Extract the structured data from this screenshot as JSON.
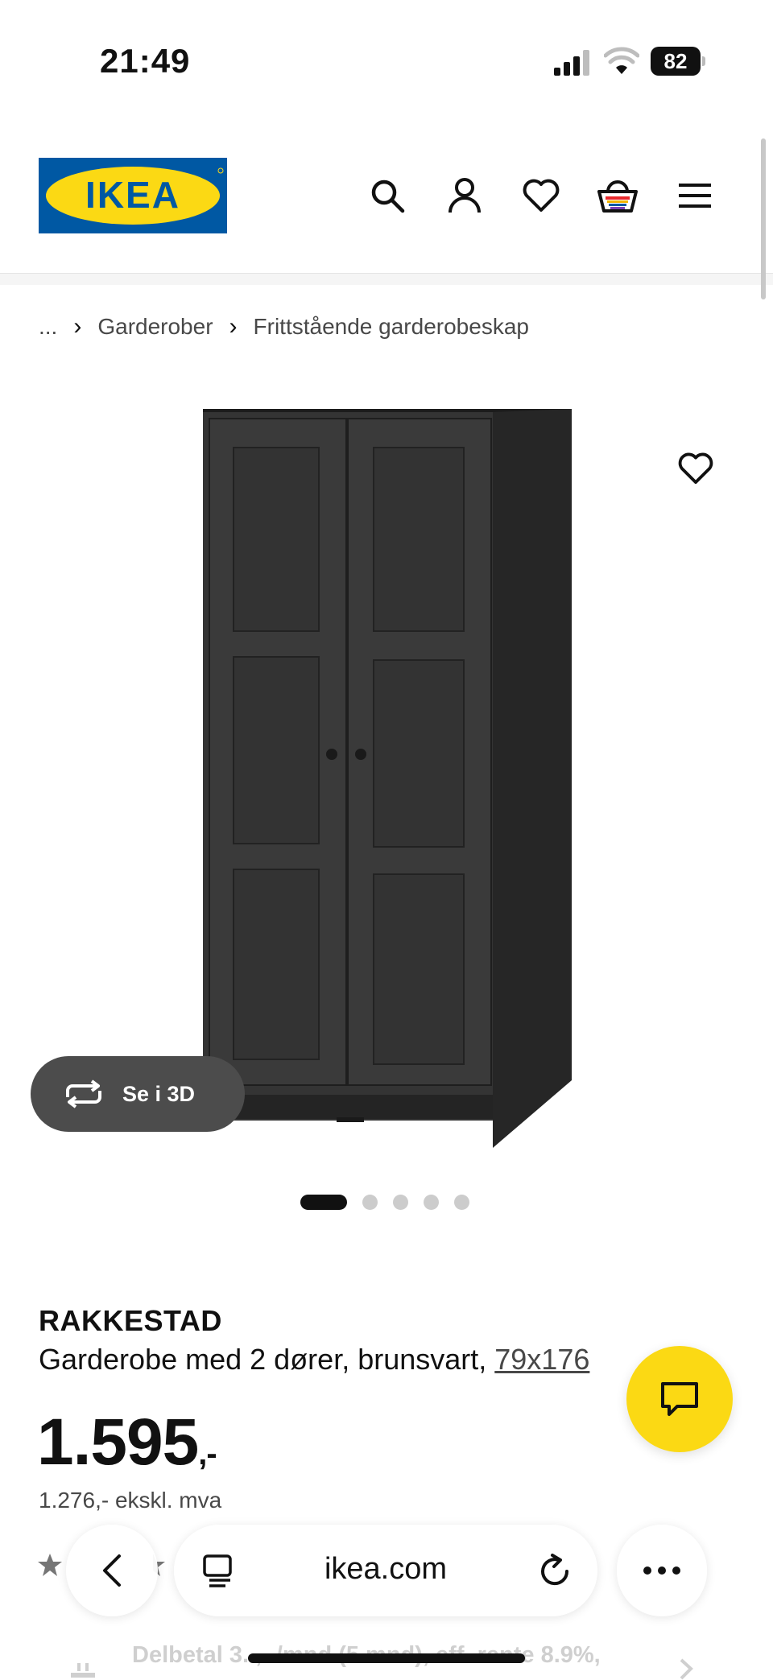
{
  "status_bar": {
    "time": "21:49",
    "battery": "82"
  },
  "header": {
    "logo_text": "IKEA"
  },
  "breadcrumb": {
    "ellipsis": "...",
    "items": [
      "Garderober",
      "Frittstående garderobeskap"
    ]
  },
  "gallery": {
    "view_3d_label": "Se i 3D",
    "image_count": 5,
    "active_index": 0
  },
  "product": {
    "name": "RAKKESTAD",
    "description": "Garderobe med 2 dører, brunsvart, ",
    "size_link": "79x176",
    "price": "1.595",
    "price_suffix": ",-",
    "price_ex_vat": "1.276,- ekskl. mva"
  },
  "installment": {
    "text": "Delbetal 3..,- /mnd (5 mnd), eff. rente 8.9%,"
  },
  "browser": {
    "url": "ikea.com"
  },
  "colors": {
    "ikea_blue": "#0058a3",
    "ikea_yellow": "#fbd914",
    "wardrobe": "#2f2f2f"
  }
}
